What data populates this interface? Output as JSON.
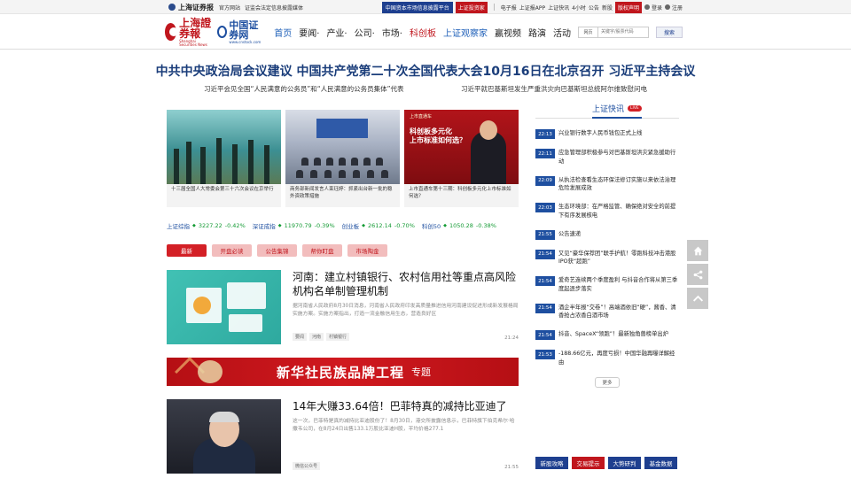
{
  "topbar": {
    "logo": "上海证券报",
    "links": [
      "官方网站",
      "证监会法定信息披露媒体"
    ],
    "platform_btn": "中国资本市场信息披露平台",
    "invest_btn": "上证投资家",
    "items": [
      "电子报",
      "上证报APP",
      "上证快讯",
      "4小时",
      "公告",
      "新股"
    ],
    "copyright_btn": "版权声明",
    "login": "登录",
    "register": "注册"
  },
  "header": {
    "logo1_cn": "上海證券報",
    "logo1_en": "Shanghai Securities News",
    "logo2_cn": "中国证券网",
    "logo2_en": "www.cnstock.com",
    "nav": [
      {
        "label": "首页",
        "style": "active"
      },
      {
        "label": "要闻·",
        "style": ""
      },
      {
        "label": "产业·",
        "style": ""
      },
      {
        "label": "公司·",
        "style": ""
      },
      {
        "label": "市场·",
        "style": ""
      },
      {
        "label": "科创板",
        "style": "red"
      },
      {
        "label": "上证观察家",
        "style": "active"
      },
      {
        "label": "赢视频",
        "style": ""
      },
      {
        "label": "路演",
        "style": ""
      },
      {
        "label": "活动",
        "style": ""
      }
    ],
    "search_scope": "网页",
    "search_placeholder": "关键字/股票代码",
    "search_button": "搜索"
  },
  "headline": "中共中央政治局会议建议 中国共产党第二十次全国代表大会10月16日在北京召开 习近平主持会议",
  "sublines": [
    "习近平会见全国“人民满意的公务员”和“人民满意的公务员集体”代表",
    "习近平就巴基斯坦发生严重洪灾向巴基斯坦总统阿尔维致慰问电"
  ],
  "tiles": [
    {
      "caption": "十三届全国人大常委会第三十六次会议在京举行"
    },
    {
      "caption": "商务部新闻发言人束珏婷：抓紧出台新一批的稳外资政策措施"
    },
    {
      "caption": "上市直通车第十三期：科创板多元化上市标准如何选？",
      "overlay_top": "上市直通车",
      "overlay_main": "科创板多元化\n上市标准如何选？"
    }
  ],
  "indices": [
    {
      "name": "上证综指",
      "value": "3227.22",
      "change": "-0.42%"
    },
    {
      "name": "深证成指",
      "value": "11970.79",
      "change": "-0.39%"
    },
    {
      "name": "创业板",
      "value": "2612.14",
      "change": "-0.70%"
    },
    {
      "name": "科创50",
      "value": "1050.28",
      "change": "-0.38%"
    }
  ],
  "tabs": [
    {
      "label": "最新",
      "active": true
    },
    {
      "label": "开盘必读",
      "active": false
    },
    {
      "label": "公告集锦",
      "active": false
    },
    {
      "label": "帮你盯盘",
      "active": false
    },
    {
      "label": "市场陶金",
      "active": false
    }
  ],
  "articles": [
    {
      "title": "河南：建立村镇银行、农村信用社等重点高风险机构名单制管理机制",
      "desc": "据河南省人民政府8月30日消息，河南省人民政府印发高质量推进信用河南建设促进形成新发展格局实施方案。实施方案指出，打造一流金融信用生态，营造良好区",
      "tags": [
        "要闻",
        "河南",
        "村镇银行"
      ],
      "time": "21:24"
    },
    {
      "title": "14年大赚33.64倍！巴菲特真的减持比亚迪了",
      "desc": "这一次，巴菲特是真的减持比亚迪股份了！8月30日，港交所披露信息示，巴菲特旗下伯克希尔·哈撒韦公司，在8月24日出售133.1万股比亚迪H股，平均价格277.1",
      "tags": [
        "微信公众号"
      ],
      "time": "21:55"
    }
  ],
  "banner": {
    "main": "新华社民族品牌工程",
    "sub": "专题"
  },
  "live": {
    "title": "上证快讯",
    "badge": "LIVE",
    "items": [
      {
        "time": "22:13",
        "text": "兴业银行数字人民币钱包正式上线"
      },
      {
        "time": "22:11",
        "text": "应急管理部积极参与对巴基斯坦洪灾紧急援助行动"
      },
      {
        "time": "22:09",
        "text": "从执法检查看生态环保法修订实施以来依法治理危险发展成效"
      },
      {
        "time": "22:03",
        "text": "生态环境部：在严格监管、确保绝对安全的前提下有序发展核电"
      },
      {
        "time": "21:55",
        "text": "公告速递"
      },
      {
        "time": "21:54",
        "text": "又见“豪华保荐团”联手护航！零跑科技冲击港股IPO获“超跑”"
      },
      {
        "time": "21:54",
        "text": "爱奇艺连续两个季度盈利 与抖音合作将从第三季度起逐步落实"
      },
      {
        "time": "21:54",
        "text": "酒企半年报“交卷”！高端酒依旧“硬”，酱香、清香抢占浓香白酒市场"
      },
      {
        "time": "21:54",
        "text": "抖音、SpaceX“领跑”！最新独角兽榜单出炉"
      },
      {
        "time": "21:53",
        "text": "-188.66亿元，再度亏损！中国华融再曝详解经由"
      }
    ],
    "more": "更多"
  },
  "quick_links": [
    {
      "label": "新股攻略",
      "red": false
    },
    {
      "label": "交易提示",
      "red": true
    },
    {
      "label": "大势研判",
      "red": false
    },
    {
      "label": "基金数据",
      "red": false
    }
  ]
}
